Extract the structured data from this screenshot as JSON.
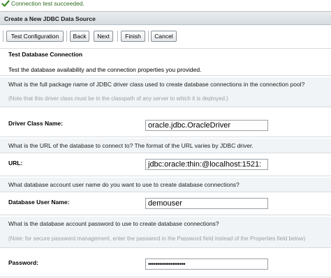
{
  "status": {
    "message": "Connection test succeeded."
  },
  "header": {
    "title": "Create a New JDBC Data Source"
  },
  "toolbar": {
    "test_configuration": "Test Configuration",
    "back": "Back",
    "next": "Next",
    "finish": "Finish",
    "cancel": "Cancel"
  },
  "section": {
    "title": "Test Database Connection",
    "description": "Test the database availability and the connection properties you provided."
  },
  "driver": {
    "question": "What is the full package name of JDBC driver class used to create database connections in the connection pool?",
    "note": "(Note that this driver class must be in the classpath of any server to which it is deployed.)",
    "label": "Driver Class Name:",
    "value": "oracle.jdbc.OracleDriver"
  },
  "url": {
    "question": "What is the URL of the database to connect to? The format of the URL varies by JDBC driver.",
    "label": "URL:",
    "value": "jdbc:oracle:thin:@localhost:1521:"
  },
  "user": {
    "question": "What database account user name do you want to use to create database connections?",
    "label": "Database User Name:",
    "value": "demouser"
  },
  "password": {
    "question": "What is the database account password to use to create database connections?",
    "note": "(Note: for secure password management, enter the password in the Password field instead of the Properties field below)",
    "label": "Password:",
    "value": "••••••••••••••••••••"
  },
  "colors": {
    "success_green": "#2e6b1f",
    "header_bg": "#dde1e5",
    "row_shade": "#f1f4f6"
  }
}
